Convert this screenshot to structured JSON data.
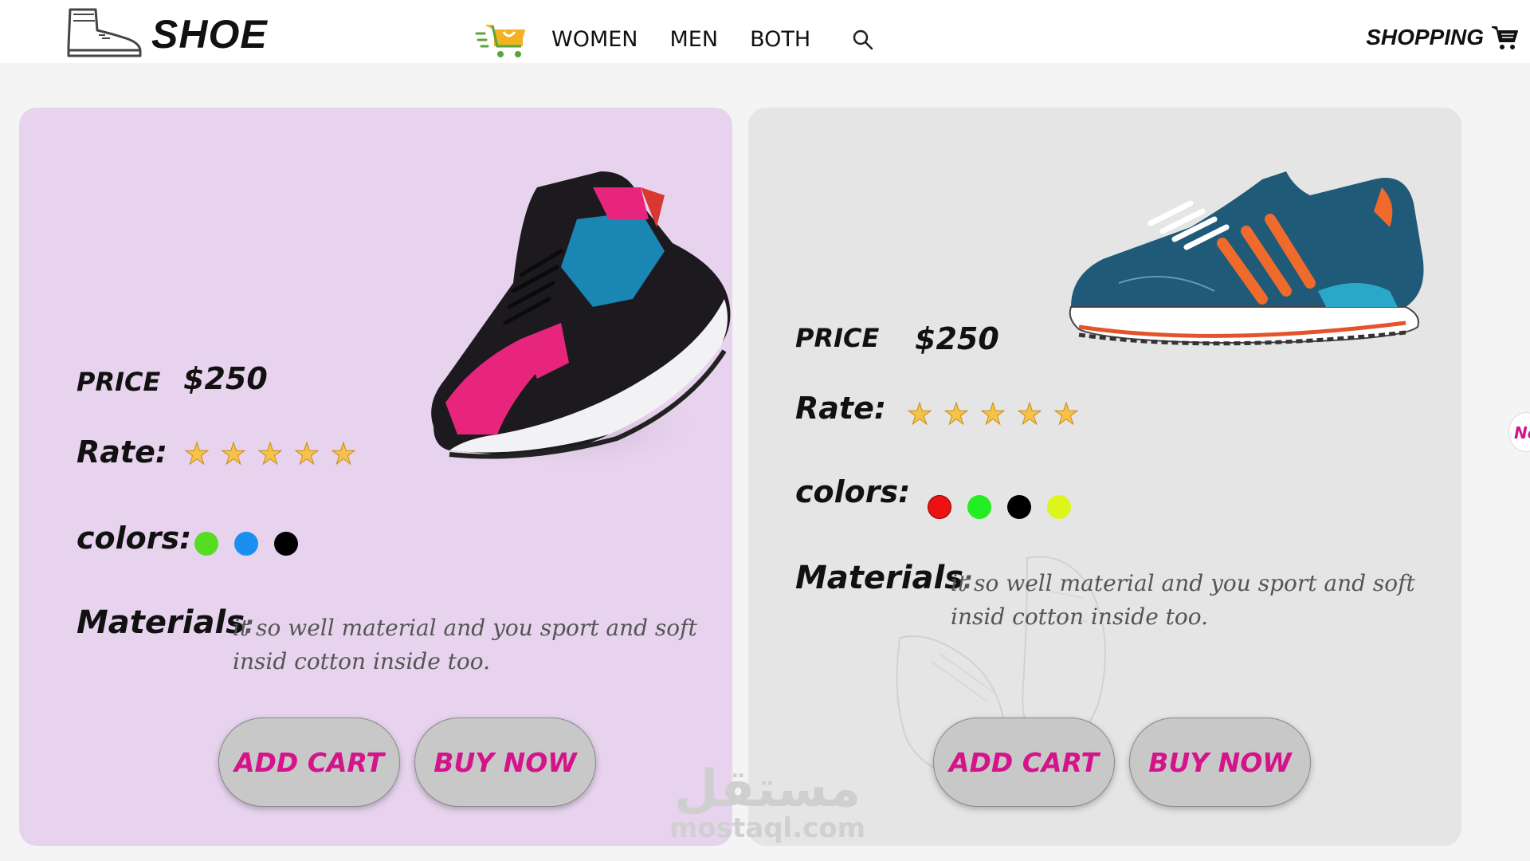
{
  "header": {
    "logo_text": "SHOE",
    "logo_icon": "boot-icon",
    "nav_icon": "cart-icon",
    "nav_links": [
      "WOMEN",
      "MEN",
      "BOTH"
    ],
    "search_icon": "search-icon",
    "shopping_label": "SHOPPING",
    "shopping_icon": "cart-icon"
  },
  "products": [
    {
      "image": "pink-black-sneaker",
      "price_label": "PRICE",
      "price_value": "$250",
      "rate_label": "Rate:",
      "rating": 5,
      "rating_max": 5,
      "colors_label": "colors:",
      "colors": [
        "#55dd22",
        "#1a8ff0",
        "#000000"
      ],
      "materials_label": "Materials",
      "materials_colon": ":",
      "materials_text": "it so well material and you sport and soft insid cotton inside too.",
      "add_cart_label": "ADD CART",
      "buy_now_label": "BUY NOW",
      "background": "#e7d3ed"
    },
    {
      "image": "blue-orange-sneaker",
      "price_label": "PRICE",
      "price_value": "$250",
      "rate_label": "Rate:",
      "rating": 5,
      "rating_max": 5,
      "colors_label": "colors:",
      "colors": [
        "#ee1111",
        "#22ee22",
        "#000000",
        "#ddf51a"
      ],
      "materials_label": "Materials",
      "materials_colon": ":",
      "materials_text": "it so well material and you sport and soft insid cotton inside too.",
      "add_cart_label": "ADD CART",
      "buy_now_label": "BUY NOW",
      "background": "#e5e5e5"
    }
  ],
  "watermark": {
    "arabic": "مستقل",
    "latin": "mostaql.com"
  },
  "next_chip_text": "Ne",
  "colors": {
    "accent": "#d4148b",
    "button_bg": "#c8c8c8",
    "star": "#e8b23a"
  }
}
